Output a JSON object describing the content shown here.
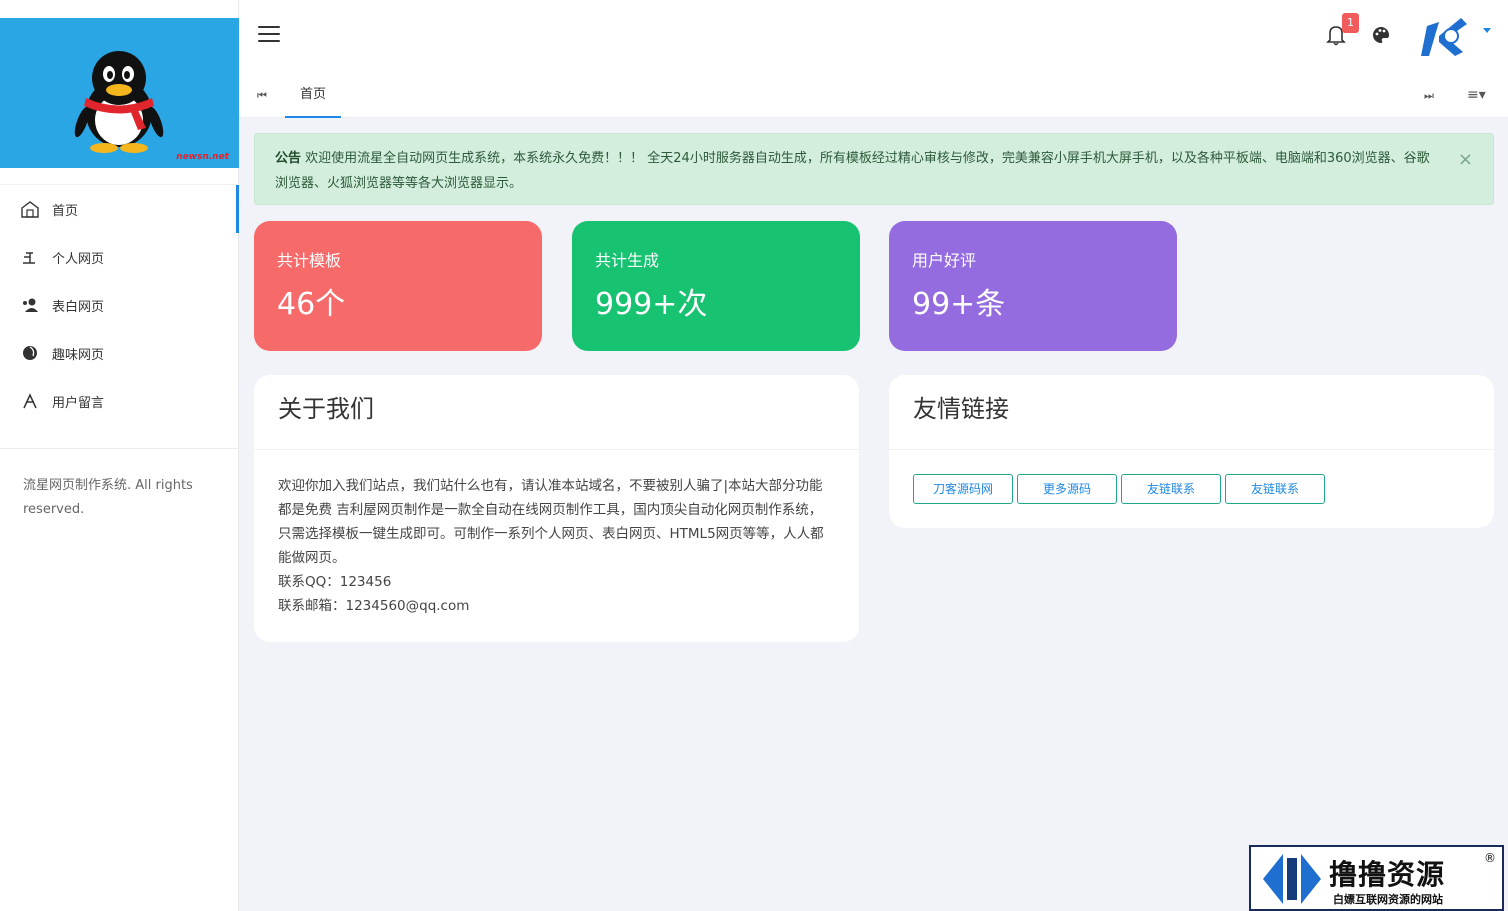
{
  "sidebar": {
    "logo_text": "newsn.net",
    "menu": [
      {
        "label": "首页",
        "icon": "home-icon",
        "active": true
      },
      {
        "label": "个人网页",
        "icon": "person-page-icon",
        "active": false
      },
      {
        "label": "表白网页",
        "icon": "users-icon",
        "active": false
      },
      {
        "label": "趣味网页",
        "icon": "globe-icon",
        "active": false
      },
      {
        "label": "用户留言",
        "icon": "message-icon",
        "active": false
      }
    ],
    "footer": "流星网页制作系统. All rights reserved."
  },
  "header": {
    "notification_count": "1",
    "icons": [
      "menu-icon",
      "bell-icon",
      "palette-icon",
      "avatar",
      "chevron-down-icon"
    ]
  },
  "tabs": {
    "home": "首页"
  },
  "notice": {
    "label": "公告",
    "text": "欢迎使用流星全自动网页生成系统，本系统永久免费！！！ 全天24小时服务器自动生成，所有模板经过精心审核与修改，完美兼容小屏手机大屏手机，以及各种平板端、电脑端和360浏览器、谷歌浏览器、火狐浏览器等等各大浏览器显示。",
    "close": "×"
  },
  "stats": [
    {
      "title": "共计模板",
      "value": "46个",
      "color": "#f76a6a"
    },
    {
      "title": "共计生成",
      "value": "999+次",
      "color": "#17c270"
    },
    {
      "title": "用户好评",
      "value": "99+条",
      "color": "#946cdf"
    }
  ],
  "about": {
    "title": "关于我们",
    "text": "欢迎你加入我们站点，我们站什么也有，请认准本站域名，不要被别人骗了|本站大部分功能都是免费 吉利屋网页制作是一款全自动在线网页制作工具，国内顶尖自动化网页制作系统，只需选择模板一键生成即可。可制作一系列个人网页、表白网页、HTML5网页等等，人人都能做网页。",
    "qq": "联系QQ：123456",
    "email": "联系邮箱：1234560@qq.com"
  },
  "links": {
    "title": "友情链接",
    "items": [
      "刀客源码网",
      "更多源码",
      "友链联系",
      "友链联系"
    ]
  },
  "watermark": {
    "title": "撸撸资源",
    "subtitle": "白嫖互联网资源的网站",
    "reg": "®"
  }
}
